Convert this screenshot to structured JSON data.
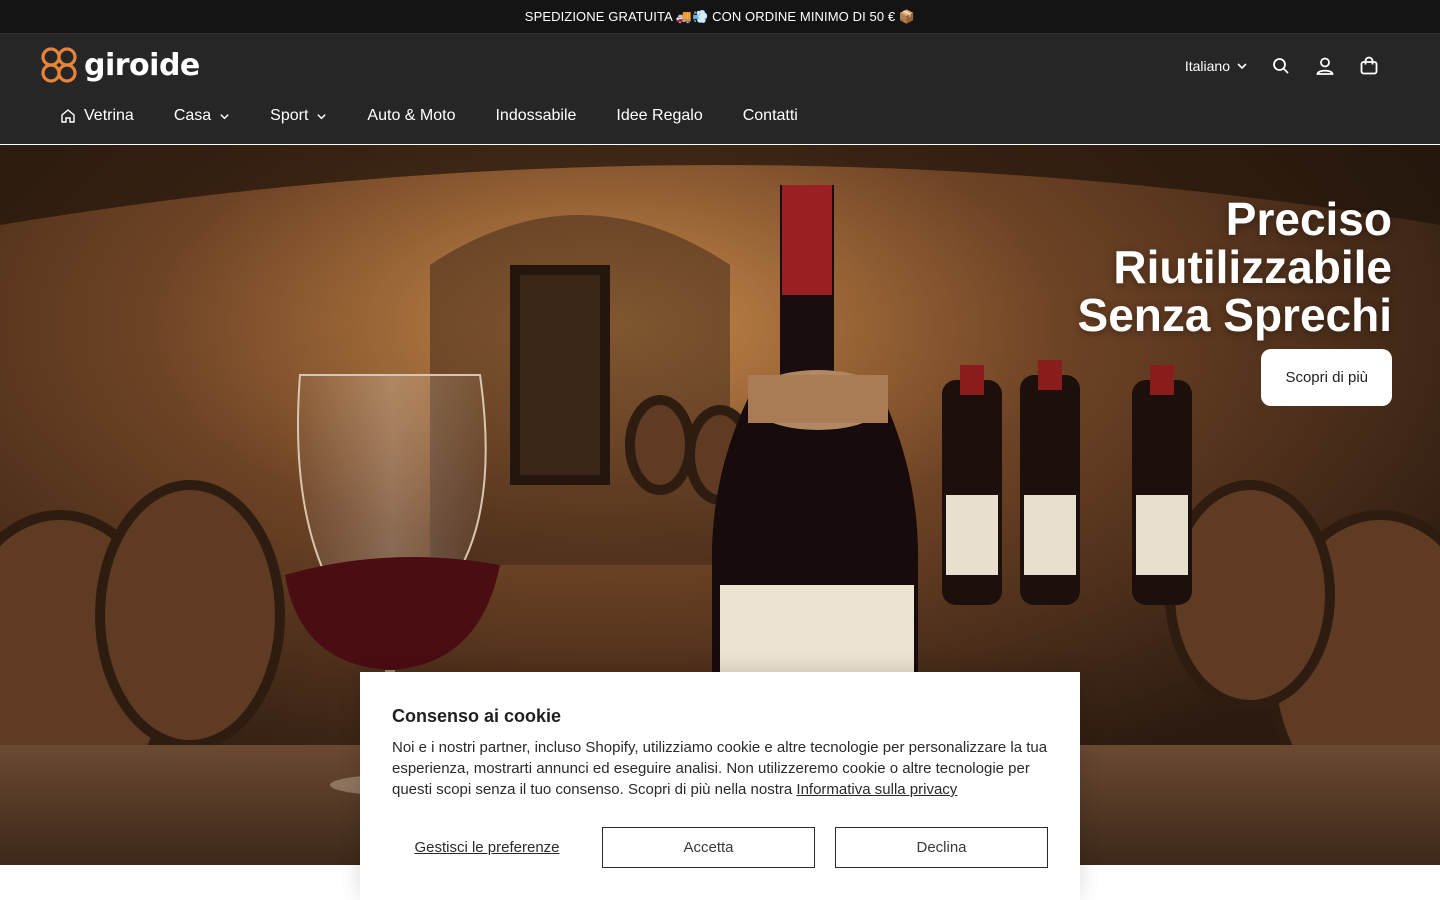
{
  "announcement": {
    "text": "SPEDIZIONE GRATUITA 🚚💨 CON ORDINE MINIMO DI 50 € 📦"
  },
  "header": {
    "logo_text": "giroide",
    "language": "Italiano",
    "icons": [
      "search-icon",
      "account-icon",
      "cart-icon"
    ]
  },
  "nav": {
    "items": [
      {
        "label": "Vetrina",
        "icon": "home-icon"
      },
      {
        "label": "Casa",
        "dropdown": true
      },
      {
        "label": "Sport",
        "dropdown": true
      },
      {
        "label": "Auto & Moto"
      },
      {
        "label": "Indossabile"
      },
      {
        "label": "Idee Regalo"
      },
      {
        "label": "Contatti"
      }
    ]
  },
  "hero": {
    "lines": [
      "Preciso",
      "Riutilizzabile",
      "Senza Sprechi"
    ],
    "button": "Scopri di più"
  },
  "cookie": {
    "title": "Consenso ai cookie",
    "body": "Noi e i nostri partner, incluso Shopify, utilizziamo cookie e altre tecnologie per personalizzare la tua esperienza, mostrarti annunci ed eseguire analisi. Non utilizzeremo cookie o altre tecnologie per questi scopi senza il tuo consenso. Scopri di più nella nostra ",
    "link": "Informativa sulla privacy",
    "prefs": "Gestisci le preferenze",
    "accept": "Accetta",
    "decline": "Declina"
  },
  "colors": {
    "brand": "#e8833a",
    "header_bg": "#262626",
    "announcement_bg": "#141414"
  }
}
